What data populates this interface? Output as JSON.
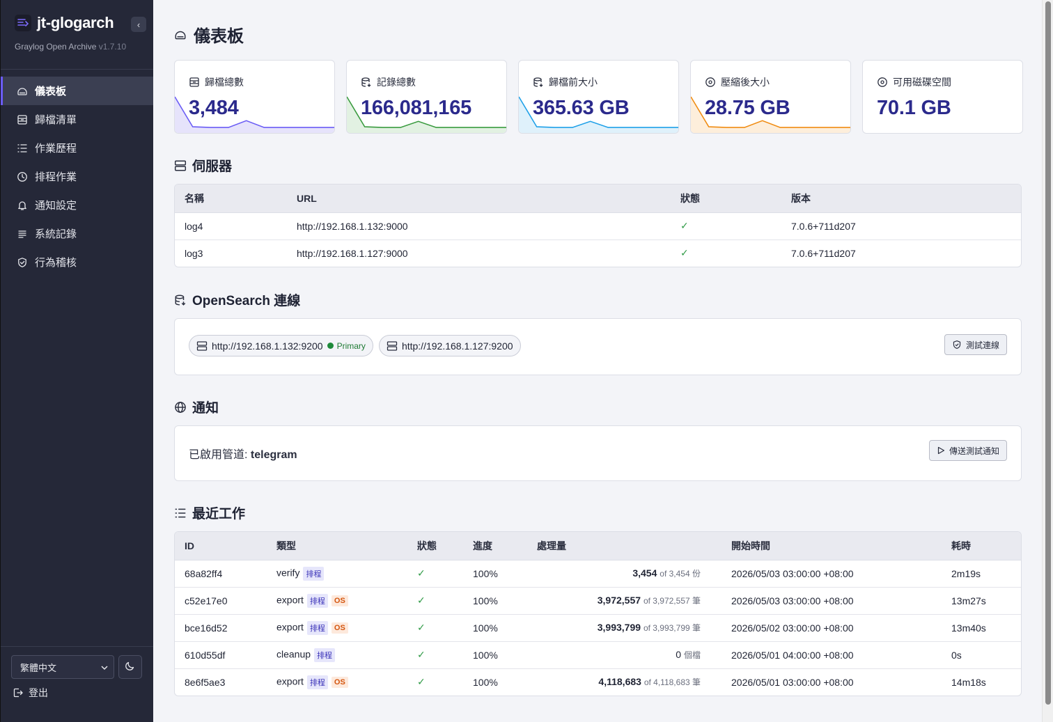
{
  "app": {
    "name": "jt-glogarch",
    "subtitle": "Graylog Open Archive",
    "version": "v1.7.10",
    "collapse_glyph": "‹"
  },
  "sidebar": {
    "items": [
      {
        "label": "儀表板",
        "icon": "home-icon",
        "active": true
      },
      {
        "label": "歸檔清單",
        "icon": "archive-icon",
        "active": false
      },
      {
        "label": "作業歷程",
        "icon": "list-icon",
        "active": false
      },
      {
        "label": "排程作業",
        "icon": "clock-icon",
        "active": false
      },
      {
        "label": "通知設定",
        "icon": "bell-icon",
        "active": false
      },
      {
        "label": "系統記錄",
        "icon": "lines-icon",
        "active": false
      },
      {
        "label": "行為稽核",
        "icon": "shield-check-icon",
        "active": false
      }
    ],
    "language": "繁體中文",
    "logout_label": "登出"
  },
  "page": {
    "title": "儀表板"
  },
  "stats": [
    {
      "label": "歸檔總數",
      "value": "3,484",
      "icon": "archive-icon",
      "color": "#6a5cf5",
      "fill": "#e6e3fb",
      "trend": [
        1.0,
        0.12,
        0.1,
        0.1,
        0.3,
        0.1,
        0.1,
        0.1,
        0.1,
        0.1
      ]
    },
    {
      "label": "記錄總數",
      "value": "166,081,165",
      "icon": "database-icon",
      "color": "#3a9b3f",
      "fill": "#e2f1e2",
      "trend": [
        1.0,
        0.12,
        0.1,
        0.1,
        0.28,
        0.1,
        0.1,
        0.1,
        0.1,
        0.1
      ]
    },
    {
      "label": "歸檔前大小",
      "value": "365.63 GB",
      "icon": "database-icon",
      "color": "#1ea0e8",
      "fill": "#dff1fb",
      "trend": [
        1.0,
        0.12,
        0.1,
        0.1,
        0.28,
        0.1,
        0.1,
        0.1,
        0.1,
        0.1
      ]
    },
    {
      "label": "壓縮後大小",
      "value": "28.75 GB",
      "icon": "disc-icon",
      "color": "#f08c12",
      "fill": "#fdeedb",
      "trend": [
        1.0,
        0.12,
        0.1,
        0.1,
        0.3,
        0.1,
        0.1,
        0.1,
        0.1,
        0.1
      ]
    },
    {
      "label": "可用磁碟空間",
      "value": "70.1 GB",
      "icon": "disc-icon"
    }
  ],
  "servers": {
    "title": "伺服器",
    "columns": [
      "名稱",
      "URL",
      "狀態",
      "版本"
    ],
    "rows": [
      {
        "name": "log4",
        "url": "http://192.168.1.132:9000",
        "status": "✓",
        "version": "7.0.6+711d207"
      },
      {
        "name": "log3",
        "url": "http://192.168.1.127:9000",
        "status": "✓",
        "version": "7.0.6+711d207"
      }
    ]
  },
  "opensearch": {
    "title": "OpenSearch 連線",
    "nodes": [
      {
        "url": "http://192.168.1.132:9200",
        "badge": "Primary"
      },
      {
        "url": "http://192.168.1.127:9200",
        "badge": ""
      }
    ],
    "test_button": "測試連線"
  },
  "notifications": {
    "title": "通知",
    "channels_label": "已啟用管道:",
    "channels_value": "telegram",
    "send_button": "傳送測試通知"
  },
  "jobs": {
    "title": "最近工作",
    "columns": [
      "ID",
      "類型",
      "狀態",
      "進度",
      "處理量",
      "開始時間",
      "耗時"
    ],
    "rows": [
      {
        "id": "68a82ff4",
        "type": "verify",
        "tags": [
          "排程"
        ],
        "status": "✓",
        "progress": "100%",
        "amount": "3,454",
        "of": "of 3,454 份",
        "start": "2026/05/03 03:00:00 +08:00",
        "duration": "2m19s"
      },
      {
        "id": "c52e17e0",
        "type": "export",
        "tags": [
          "排程",
          "OS"
        ],
        "status": "✓",
        "progress": "100%",
        "amount": "3,972,557",
        "of": "of 3,972,557 筆",
        "start": "2026/05/03 03:00:00 +08:00",
        "duration": "13m27s"
      },
      {
        "id": "bce16d52",
        "type": "export",
        "tags": [
          "排程",
          "OS"
        ],
        "status": "✓",
        "progress": "100%",
        "amount": "3,993,799",
        "of": "of 3,993,799 筆",
        "start": "2026/05/02 03:00:00 +08:00",
        "duration": "13m40s"
      },
      {
        "id": "610d55df",
        "type": "cleanup",
        "tags": [
          "排程"
        ],
        "status": "✓",
        "progress": "100%",
        "amount": "0",
        "of": "個檔",
        "start": "2026/05/01 04:00:00 +08:00",
        "duration": "0s",
        "amount_plain": true
      },
      {
        "id": "8e6f5ae3",
        "type": "export",
        "tags": [
          "排程",
          "OS"
        ],
        "status": "✓",
        "progress": "100%",
        "amount": "4,118,683",
        "of": "of 4,118,683 筆",
        "start": "2026/05/01 03:00:00 +08:00",
        "duration": "14m18s"
      }
    ]
  }
}
